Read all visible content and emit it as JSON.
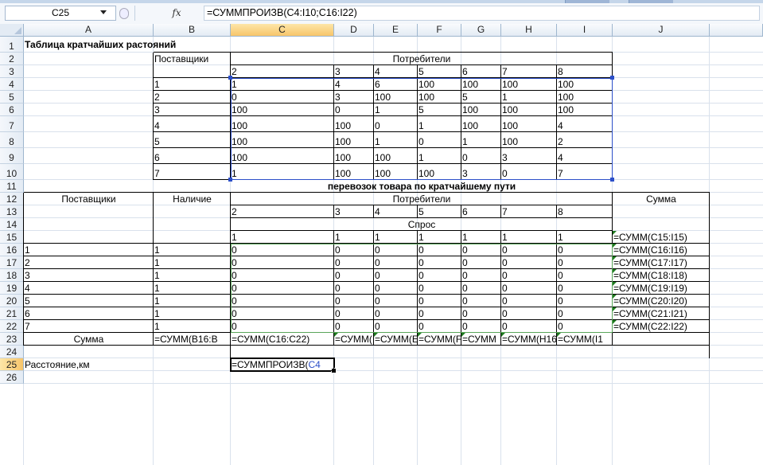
{
  "formula_bar": {
    "name_box": "C25",
    "fx_label": "fx",
    "formula": "=СУММПРОИЗВ(C4:I10;C16:I22)"
  },
  "columns": [
    "A",
    "B",
    "C",
    "D",
    "E",
    "F",
    "G",
    "H",
    "I",
    "J"
  ],
  "rows": [
    "1",
    "2",
    "3",
    "4",
    "5",
    "6",
    "7",
    "8",
    "9",
    "10",
    "11",
    "12",
    "13",
    "14",
    "15",
    "16",
    "17",
    "18",
    "19",
    "20",
    "21",
    "22",
    "23",
    "24",
    "25",
    "26"
  ],
  "selection": {
    "column": "C",
    "row": "25"
  },
  "cells": {
    "A1": "Таблица кратчайших растояний",
    "B2": "Поставщики",
    "C2": "Потребители",
    "C3": "2",
    "D3": "3",
    "E3": "4",
    "F3": "5",
    "G3": "6",
    "H3": "7",
    "I3": "8",
    "B4": "1",
    "C4": "1",
    "D4": "4",
    "E4": "6",
    "F4": "100",
    "G4": "100",
    "H4": "100",
    "I4": "100",
    "B5": "2",
    "C5": "0",
    "D5": "3",
    "E5": "100",
    "F5": "100",
    "G5": "5",
    "H5": "1",
    "I5": "100",
    "B6": "3",
    "C6": "100",
    "D6": "0",
    "E6": "1",
    "F6": "5",
    "G6": "100",
    "H6": "100",
    "I6": "100",
    "B7": "4",
    "C7": "100",
    "D7": "100",
    "E7": "0",
    "F7": "1",
    "G7": "100",
    "H7": "100",
    "I7": "4",
    "B8": "5",
    "C8": "100",
    "D8": "100",
    "E8": "1",
    "F8": "0",
    "G8": "1",
    "H8": "100",
    "I8": "2",
    "B9": "6",
    "C9": "100",
    "D9": "100",
    "E9": "100",
    "F9": "1",
    "G9": "0",
    "H9": "3",
    "I9": "4",
    "B10": "7",
    "C10": "1",
    "D10": "100",
    "E10": "100",
    "F10": "100",
    "G10": "3",
    "H10": "0",
    "I10": "7",
    "C11": "перевозок товара по кратчайшему пути",
    "A12": "Поставщики",
    "B12": "Наличие",
    "C12": "Потребители",
    "J12": "Сумма",
    "C13": "2",
    "D13": "3",
    "E13": "4",
    "F13": "5",
    "G13": "6",
    "H13": "7",
    "I13": "8",
    "C14": "Спрос",
    "C15": "1",
    "D15": "1",
    "E15": "1",
    "F15": "1",
    "G15": "1",
    "H15": "1",
    "I15": "1",
    "J15": "=СУММ(C15:I15)",
    "A16": "1",
    "B16": "1",
    "C16": "0",
    "D16": "0",
    "E16": "0",
    "F16": "0",
    "G16": "0",
    "H16": "0",
    "I16": "0",
    "J16": "=СУММ(C16:I16)",
    "A17": "2",
    "B17": "1",
    "C17": "0",
    "D17": "0",
    "E17": "0",
    "F17": "0",
    "G17": "0",
    "H17": "0",
    "I17": "0",
    "J17": "=СУММ(C17:I17)",
    "A18": "3",
    "B18": "1",
    "C18": "0",
    "D18": "0",
    "E18": "0",
    "F18": "0",
    "G18": "0",
    "H18": "0",
    "I18": "0",
    "J18": "=СУММ(C18:I18)",
    "A19": "4",
    "B19": "1",
    "C19": "0",
    "D19": "0",
    "E19": "0",
    "F19": "0",
    "G19": "0",
    "H19": "0",
    "I19": "0",
    "J19": "=СУММ(C19:I19)",
    "A20": "5",
    "B20": "1",
    "C20": "0",
    "D20": "0",
    "E20": "0",
    "F20": "0",
    "G20": "0",
    "H20": "0",
    "I20": "0",
    "J20": "=СУММ(C20:I20)",
    "A21": "6",
    "B21": "1",
    "C21": "0",
    "D21": "0",
    "E21": "0",
    "F21": "0",
    "G21": "0",
    "H21": "0",
    "I21": "0",
    "J21": "=СУММ(C21:I21)",
    "A22": "7",
    "B22": "1",
    "C22": "0",
    "D22": "0",
    "E22": "0",
    "F22": "0",
    "G22": "0",
    "H22": "0",
    "I22": "0",
    "J22": "=СУММ(C22:I22)",
    "A23": "Сумма",
    "B23": "=СУММ(B16:B",
    "C23": "=СУММ(C16:C22)",
    "D23": "=СУММ(",
    "E23": "=СУММ(E1",
    "F23": "=СУММ(F",
    "G23": "=СУММ",
    "H23": "=СУММ(H16",
    "I23": "=СУММ(I1",
    "A25": "Расстояние,км",
    "C25_prefix": "=СУММПРОИЗВ(",
    "C25_ref": "C4"
  }
}
